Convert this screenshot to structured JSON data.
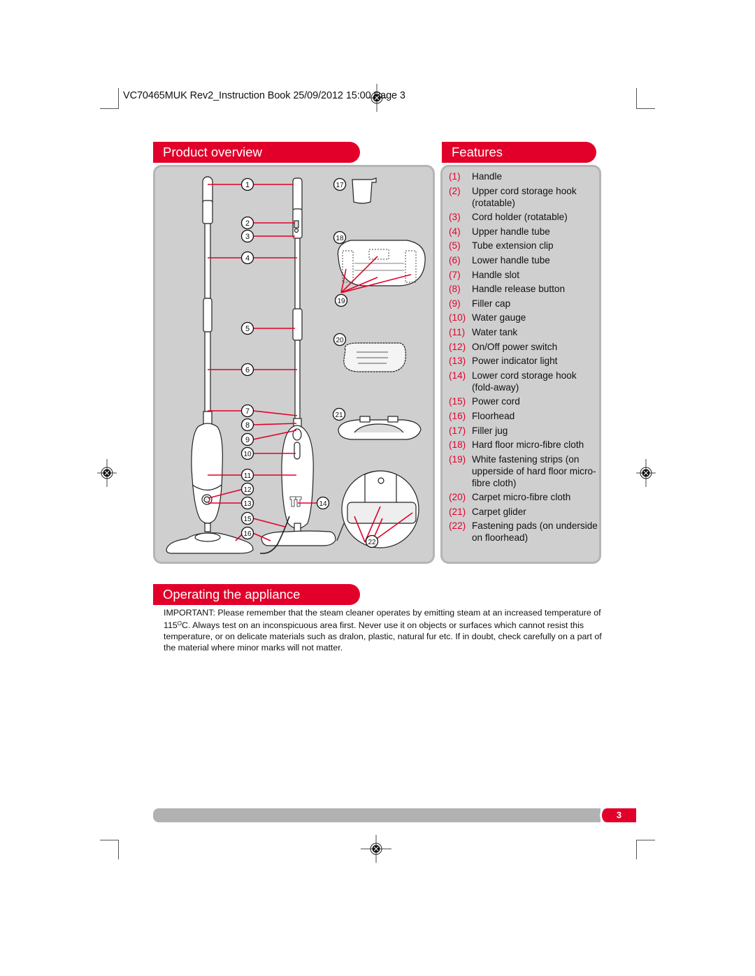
{
  "print_header": {
    "text": "VC70465MUK Rev2_Instruction Book  25/09/2012  15:00  Page 3"
  },
  "sections": {
    "product_overview": {
      "title": "Product overview",
      "callouts": [
        "1",
        "2",
        "3",
        "4",
        "5",
        "6",
        "7",
        "8",
        "9",
        "10",
        "11",
        "12",
        "13",
        "14",
        "15",
        "16",
        "17",
        "18",
        "19",
        "20",
        "21",
        "22"
      ]
    },
    "features": {
      "title": "Features",
      "items": [
        {
          "num": "(1)",
          "label": "Handle"
        },
        {
          "num": "(2)",
          "label": "Upper cord storage hook (rotatable)"
        },
        {
          "num": "(3)",
          "label": "Cord holder (rotatable)"
        },
        {
          "num": "(4)",
          "label": "Upper handle tube"
        },
        {
          "num": "(5)",
          "label": "Tube extension clip"
        },
        {
          "num": "(6)",
          "label": "Lower handle tube"
        },
        {
          "num": "(7)",
          "label": "Handle slot"
        },
        {
          "num": "(8)",
          "label": "Handle release button"
        },
        {
          "num": "(9)",
          "label": "Filler cap"
        },
        {
          "num": "(10)",
          "label": "Water gauge"
        },
        {
          "num": "(11)",
          "label": "Water tank"
        },
        {
          "num": "(12)",
          "label": "On/Off power switch"
        },
        {
          "num": "(13)",
          "label": "Power indicator light"
        },
        {
          "num": "(14)",
          "label": "Lower cord storage hook (fold-away)"
        },
        {
          "num": "(15)",
          "label": "Power cord"
        },
        {
          "num": "(16)",
          "label": "Floorhead"
        },
        {
          "num": "(17)",
          "label": "Filler jug"
        },
        {
          "num": "(18)",
          "label": "Hard floor micro-fibre cloth"
        },
        {
          "num": "(19)",
          "label": "White fastening strips (on upperside of hard floor micro-fibre cloth)"
        },
        {
          "num": "(20)",
          "label": "Carpet micro-fibre cloth"
        },
        {
          "num": "(21)",
          "label": "Carpet glider"
        },
        {
          "num": "(22)",
          "label": "Fastening pads (on underside on floorhead)"
        }
      ]
    },
    "operating": {
      "title": "Operating the appliance",
      "body_before_sup": "IMPORTANT: Please remember that the steam cleaner operates by emitting steam at an increased temperature of 115",
      "sup": "O",
      "body_after_sup": "C. Always test on an inconspicuous area first. Never use it on objects or surfaces which cannot resist this temperature, or on delicate materials such as dralon, plastic, natural fur etc. If in doubt, check carefully on a part of the material where minor marks will not matter."
    }
  },
  "footer": {
    "page_number": "3"
  },
  "colors": {
    "accent": "#e2002a",
    "panel": "#cfcfcf",
    "footer_bar": "#b2b2b2"
  }
}
